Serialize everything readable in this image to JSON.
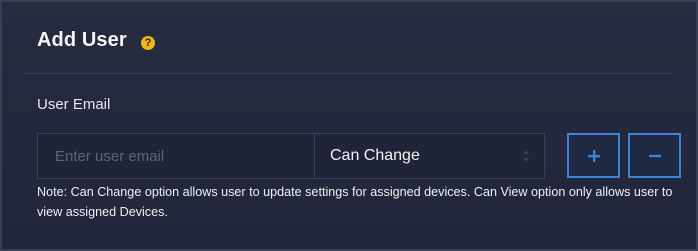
{
  "header": {
    "title": "Add User",
    "help_icon": "question-circle-icon",
    "help_glyph": "?"
  },
  "form": {
    "email_label": "User Email",
    "email_placeholder": "Enter user email",
    "email_value": "",
    "permission": {
      "selected": "Can Change",
      "options_visible": [
        "Can Change"
      ]
    },
    "add_button_icon": "plus-icon",
    "remove_button_icon": "minus-icon",
    "note": "Note: Can Change option allows user to update settings for assigned devices. Can View option only allows user to view assigned Devices."
  },
  "colors": {
    "panel_bg": "#23283a",
    "accent_blue": "#3b84d8",
    "help_icon_yellow": "#f2b51a",
    "text": "#ffffff",
    "placeholder": "#5d647a"
  }
}
